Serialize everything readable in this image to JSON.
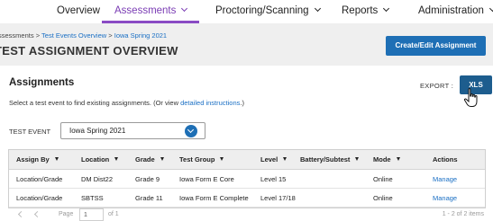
{
  "nav": {
    "items": [
      {
        "label": "Overview"
      },
      {
        "label": "Assessments"
      },
      {
        "label": "Proctoring/Scanning"
      },
      {
        "label": "Reports"
      },
      {
        "label": "Administration"
      }
    ],
    "active": "Assessments"
  },
  "header": {
    "breadcrumb": {
      "root": "Assessments",
      "sep": ">",
      "crumb2": "Test Events Overview",
      "crumb3": "Iowa Spring 2021"
    },
    "title": "TEST ASSIGNMENT OVERVIEW",
    "create_button": "Create/Edit Assignment"
  },
  "assignments": {
    "title": "Assignments",
    "export_label": "EXPORT :",
    "xls_button": "XLS",
    "instructions_prefix": "Select a test event to find existing assignments. (Or view ",
    "instructions_link": "detailed instructions",
    "instructions_suffix": ".)"
  },
  "filter": {
    "label": "TEST EVENT",
    "selected": "Iowa Spring 2021"
  },
  "table": {
    "columns": [
      "Assign By",
      "Location",
      "Grade",
      "Test Group",
      "Level",
      "Battery/Subtest",
      "Mode",
      "Actions"
    ],
    "rows": [
      {
        "assign_by": "Location/Grade",
        "location": "DM Dist22",
        "grade": "Grade 9",
        "test_group": "Iowa Form E Core",
        "level": "Level 15",
        "battery": "",
        "mode": "Online",
        "action": "Manage"
      },
      {
        "assign_by": "Location/Grade",
        "location": "SBTSS",
        "grade": "Grade 11",
        "test_group": "Iowa Form E Complete",
        "level": "Level 17/18",
        "battery": "",
        "mode": "Online",
        "action": "Manage"
      }
    ]
  },
  "pager": {
    "page_label": "Page",
    "page_value": "1",
    "of_label": "of 1",
    "range_text": "1 - 2 of 2 items"
  },
  "colors": {
    "accent_purple": "#8a4bc4",
    "primary_blue": "#1e6fb5",
    "link_blue": "#1a6fc4"
  }
}
